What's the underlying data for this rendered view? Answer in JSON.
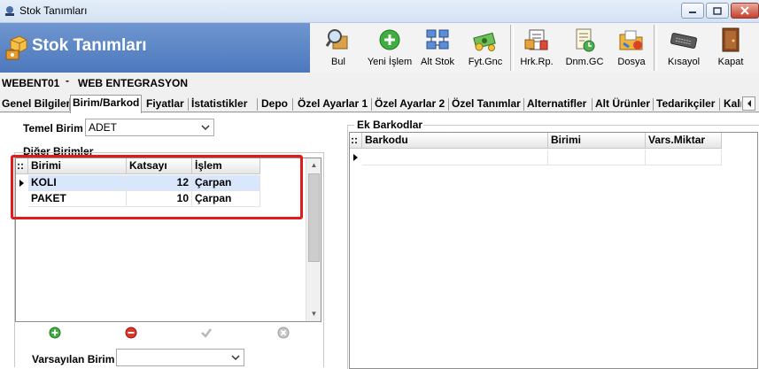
{
  "window": {
    "title": "Stok Tanımları",
    "controls": {
      "minimize": "–",
      "maximize": "□",
      "close": "✕"
    }
  },
  "banner": {
    "title": "Stok Tanımları"
  },
  "toolbar": {
    "group1": [
      {
        "label": "Bul",
        "icon": "search-box-icon"
      },
      {
        "label": "Yeni İşlem",
        "icon": "plus-circle-icon"
      },
      {
        "label": "Alt Stok",
        "icon": "network-icon"
      },
      {
        "label": "Fyt.Gnc",
        "icon": "money-icon"
      }
    ],
    "group2": [
      {
        "label": "Hrk.Rp.",
        "icon": "report-icon"
      },
      {
        "label": "Dnm.GC",
        "icon": "document-clock-icon"
      },
      {
        "label": "Dosya",
        "icon": "folder-icon"
      }
    ],
    "group3": [
      {
        "label": "Kısayol",
        "icon": "keyboard-icon"
      },
      {
        "label": "Kapat",
        "icon": "exit-door-icon"
      }
    ]
  },
  "info": {
    "code": "WEBENT01",
    "separator": "-",
    "name": "WEB ENTEGRASYON"
  },
  "tabs": [
    "Genel Bilgiler",
    "Birim/Barkod",
    "Fiyatlar",
    "İstatistikler",
    "Depo",
    "Özel Ayarlar 1",
    "Özel Ayarlar 2",
    "Özel Tanımlar",
    "Alternatifler",
    "Alt Ürünler",
    "Tedarikçiler",
    "Kalı"
  ],
  "active_tab": "Birim/Barkod",
  "temel_birim": {
    "label": "Temel Birim",
    "value": "ADET"
  },
  "diger_birimler": {
    "title": "Diğer Birimler",
    "columns": [
      "::",
      "Birimi",
      "Katsayı",
      "İşlem"
    ],
    "rows": [
      {
        "birimi": "KOLI",
        "katsayi": "12",
        "islem": "Çarpan",
        "selected": true
      },
      {
        "birimi": "PAKET",
        "katsayi": "10",
        "islem": "Çarpan",
        "selected": false
      }
    ]
  },
  "varsayilan_birim": {
    "label": "Varsayılan Birim",
    "value": ""
  },
  "ek_barkodlar": {
    "title": "Ek Barkodlar",
    "columns": [
      "::",
      "Barkodu",
      "Birimi",
      "Vars.Miktar"
    ]
  },
  "colors": {
    "banner": "#5a83c4",
    "highlight": "#e01b1b",
    "selection": "#d8e7fb"
  }
}
